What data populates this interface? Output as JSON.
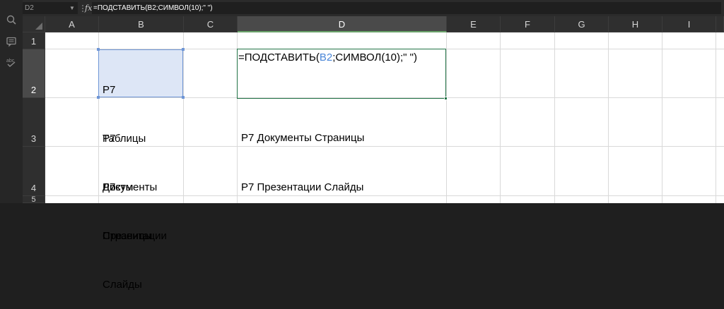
{
  "formula_bar": {
    "name_box": "D2",
    "fx": "fx",
    "formula": "=ПОДСТАВИТЬ(B2;СИМВОЛ(10);\" \")"
  },
  "sidebar": {
    "icons": [
      "search-icon",
      "comment-icon",
      "spell-check-icon"
    ]
  },
  "columns": [
    "A",
    "B",
    "C",
    "D",
    "E",
    "F",
    "G",
    "H",
    "I"
  ],
  "rows": [
    "1",
    "2",
    "3",
    "4",
    "5"
  ],
  "cells": {
    "B2": [
      "Р7",
      "Таблицы",
      "Листы"
    ],
    "B3": [
      "Р7",
      "Документы",
      "Страницы"
    ],
    "B4": [
      "Р7",
      "Презентации",
      "Слайды"
    ],
    "D2": {
      "prefix": "=ПОДСТАВИТЬ(",
      "ref": "B2",
      "suffix": ";СИМВОЛ(10);\" \")"
    },
    "D3": "Р7 Документы Страницы",
    "D4": "Р7 Презентации Слайды"
  },
  "colors": {
    "active_cell_border": "#217346",
    "selection_fill": "#dde6f6",
    "reference_blue": "#4a86d8"
  }
}
